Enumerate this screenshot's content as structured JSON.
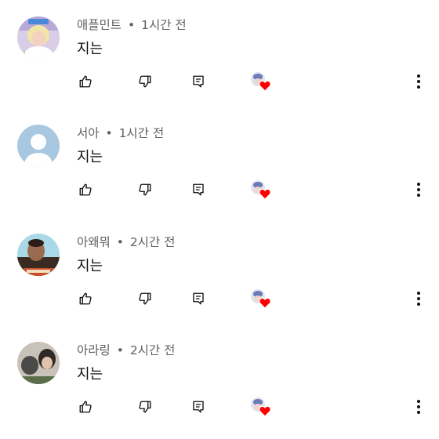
{
  "comments": [
    {
      "author": "애플민트",
      "separator": "•",
      "time": "1시간 전",
      "text": "지는",
      "avatar": "avatar-blond-person-photo"
    },
    {
      "author": "서아",
      "separator": "•",
      "time": "1시간 전",
      "text": "지는",
      "avatar": "default-user-avatar"
    },
    {
      "author": "아왜뭐",
      "separator": "•",
      "time": "2시간 전",
      "text": "지는",
      "avatar": "avatar-man-photo"
    },
    {
      "author": "아라링",
      "separator": "•",
      "time": "2시간 전",
      "text": "지는",
      "avatar": "avatar-two-people-photo"
    }
  ],
  "icons": {
    "like": "thumbs-up-icon",
    "dislike": "thumbs-down-icon",
    "reply": "reply-comment-icon",
    "creator_heart": "creator-heart-icon",
    "more": "more-vertical-icon"
  },
  "colors": {
    "heart": "#ff0000",
    "text": "#0f0f0f",
    "meta": "#606060",
    "icon": "#0f0f0f"
  }
}
